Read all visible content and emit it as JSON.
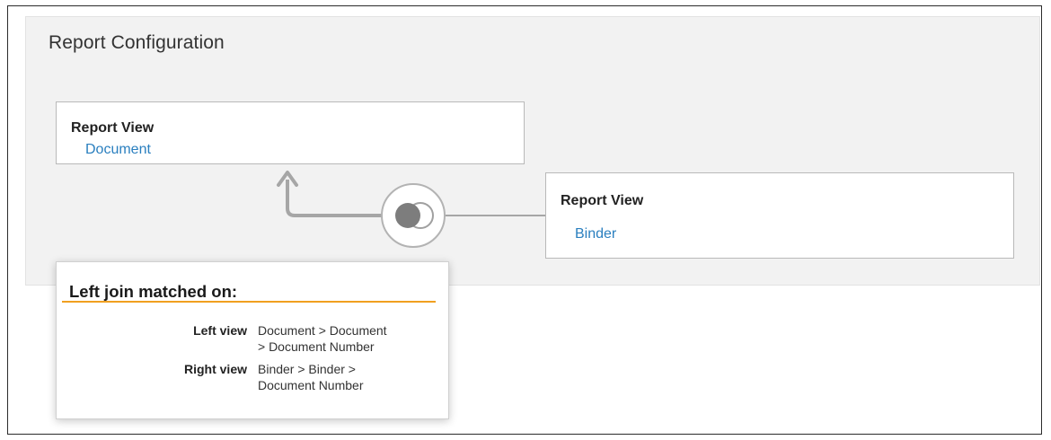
{
  "header": {
    "title": "Report Configuration"
  },
  "left_view": {
    "heading": "Report View",
    "name": "Document"
  },
  "right_view": {
    "heading": "Report View",
    "name": "Binder"
  },
  "join": {
    "icon": "venn-join-icon",
    "popup": {
      "title": "Left join matched on:",
      "left_label": "Left view",
      "left_path_line1": "Document > Document",
      "left_path_line2": "> Document Number",
      "right_label": "Right view",
      "right_path_line1": "Binder > Binder >",
      "right_path_line2": "Document Number"
    }
  },
  "colors": {
    "link": "#2a7fbf",
    "accent_underline": "#f0a020",
    "panel_background": "#f2f2f2"
  }
}
